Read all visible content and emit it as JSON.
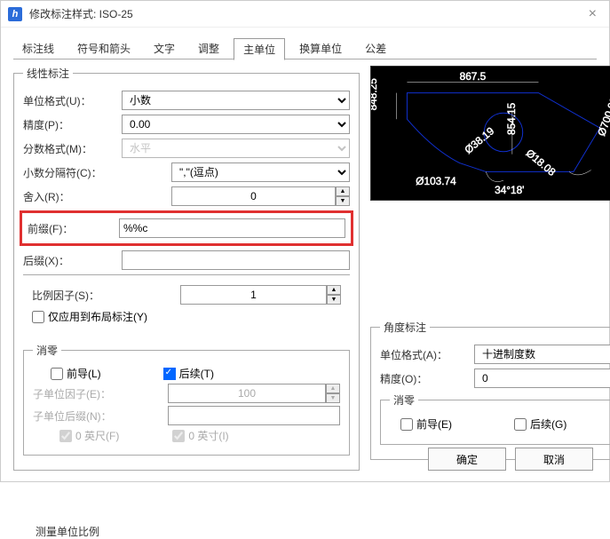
{
  "window": {
    "title": "修改标注样式: ISO-25"
  },
  "tabs": {
    "t1": "标注线",
    "t2": "符号和箭头",
    "t3": "文字",
    "t4": "调整",
    "t5": "主单位",
    "t6": "换算单位",
    "t7": "公差"
  },
  "linear": {
    "legend": "线性标注",
    "unit_format_label": "单位格式(U)：",
    "unit_format": "小数",
    "precision_label": "精度(P)：",
    "precision": "0.00",
    "fraction_label": "分数格式(M)：",
    "fraction": "水平",
    "decimal_sep_label": "小数分隔符(C)：",
    "decimal_sep": "\",\"(逗点)",
    "round_label": "舍入(R)：",
    "round": "0",
    "prefix_label": "前缀(F)：",
    "prefix": "%%c",
    "suffix_label": "后缀(X)：",
    "suffix": ""
  },
  "scale": {
    "legend": "测量单位比例",
    "factor_label": "比例因子(S)：",
    "factor": "1",
    "apply_layout": "仅应用到布局标注(Y)"
  },
  "zero_l": {
    "legend": "消零",
    "leading": "前导(L)",
    "trailing": "后续(T)",
    "subfactor_label": "子单位因子(E)：",
    "subfactor": "100",
    "subsuffix_label": "子单位后缀(N)：",
    "subsuffix": "",
    "feet": "0 英尺(F)",
    "inch": "0 英寸(I)"
  },
  "angular": {
    "legend": "角度标注",
    "unit_label": "单位格式(A)：",
    "unit": "十进制度数",
    "precision_label": "精度(O)：",
    "precision": "0"
  },
  "zero_a": {
    "legend": "消零",
    "leading": "前导(E)",
    "trailing": "后续(G)"
  },
  "buttons": {
    "ok": "确定",
    "cancel": "取消"
  },
  "icon_letter": "h"
}
